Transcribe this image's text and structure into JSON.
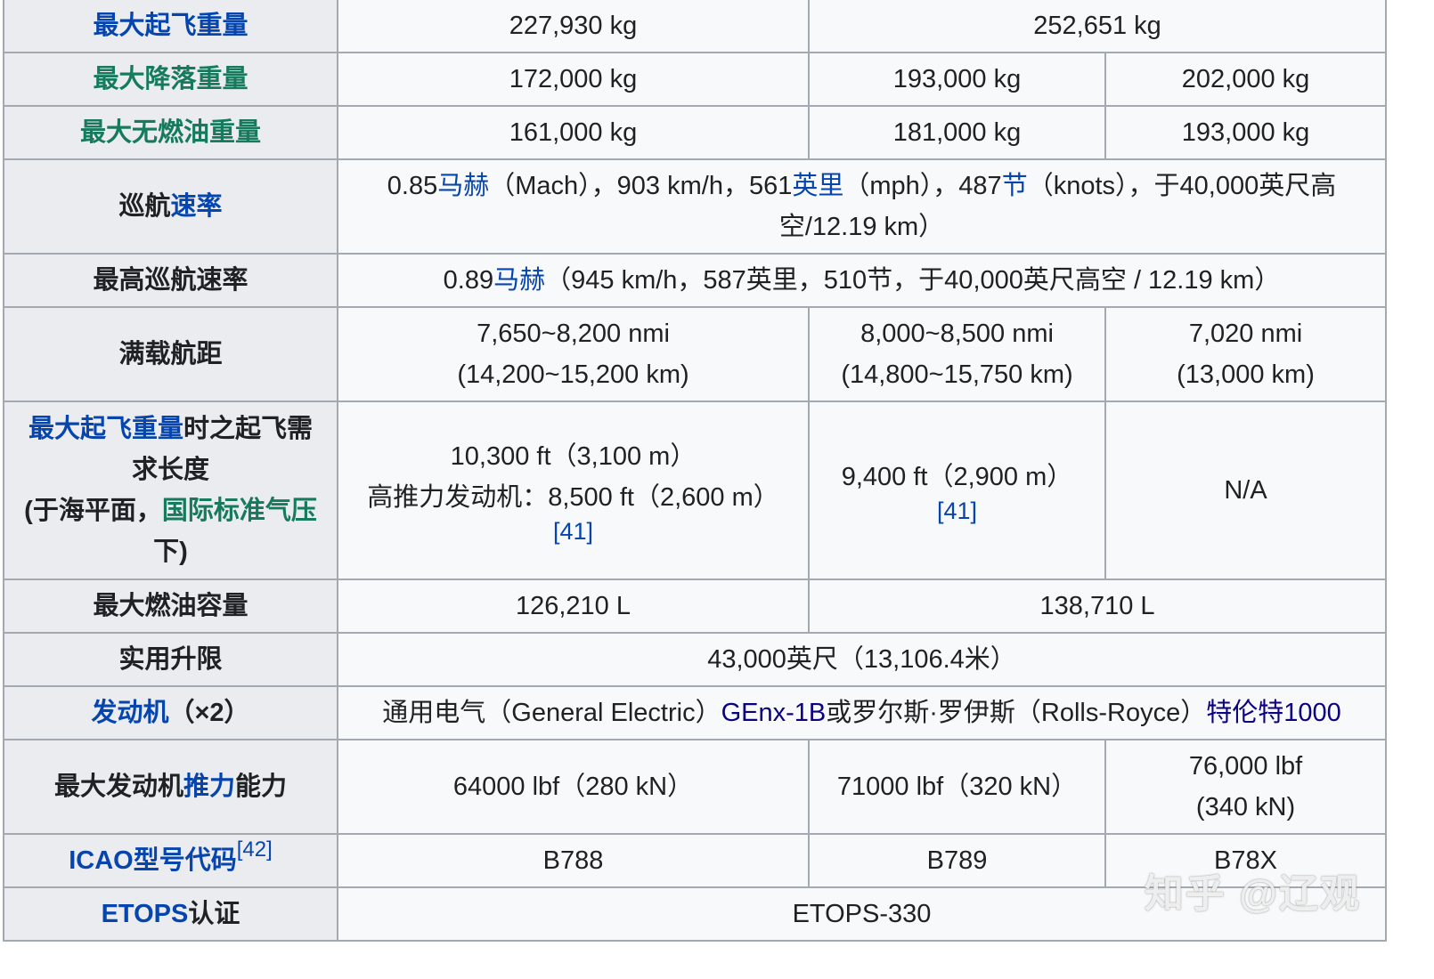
{
  "rows": {
    "mtow": {
      "label": "最大起飞重量",
      "v1": "227,930 kg",
      "v2": "252,651 kg"
    },
    "mlw": {
      "label": "最大降落重量",
      "v1": "172,000 kg",
      "v2": "193,000 kg",
      "v3": "202,000 kg"
    },
    "mzfw": {
      "label": "最大无燃油重量",
      "v1": "161,000 kg",
      "v2": "181,000 kg",
      "v3": "193,000 kg"
    },
    "cruise": {
      "label_pre": "巡航",
      "label_link": "速率",
      "p1": "0.85",
      "l1": "马赫",
      "p2": "（Mach），903 km/h，561",
      "l2": "英里",
      "p3": "（mph），487",
      "l3": "节",
      "p4": "（knots），于40,000英尺高",
      "p5": "空/12.19 km）"
    },
    "maxcruise": {
      "label": "最高巡航速率",
      "p1": "0.89",
      "l1": "马赫",
      "p2": "（945 km/h，587英里，510节，于40,000英尺高空 / 12.19 km）"
    },
    "range": {
      "label": "满载航距",
      "v1a": "7,650~8,200 nmi",
      "v1b": "(14,200~15,200 km)",
      "v2a": "8,000~8,500 nmi",
      "v2b": "(14,800~15,750 km)",
      "v3a": "7,020 nmi",
      "v3b": "(13,000 km)"
    },
    "takeoff": {
      "label_link1": "最大起飞重量",
      "label_t1": "时之起飞需",
      "label_t2": "求长度",
      "label_t3": "(于海平面，",
      "label_link2": "国际标准气压",
      "label_t4": "下)",
      "v1a": "10,300 ft（3,100 m）",
      "v1b": "高推力发动机：8,500 ft（2,600 m）",
      "v1ref": "[41]",
      "v2a": "9,400 ft（2,900 m）",
      "v2ref": "[41]",
      "v3": "N/A"
    },
    "fuel": {
      "label": "最大燃油容量",
      "v1": "126,210 L",
      "v2": "138,710 L"
    },
    "ceiling": {
      "label": "实用升限",
      "v": "43,000英尺（13,106.4米）"
    },
    "engines": {
      "label_link": "发动机",
      "label_suffix": "（×2）",
      "p1": "通用电气（General Electric）",
      "l1": "GEnx-1B",
      "p2": "或罗尔斯·罗伊斯（Rolls-Royce）",
      "l2": "特伦特1000"
    },
    "thrust": {
      "label_pre": "最大发动机",
      "label_link": "推力",
      "label_post": "能力",
      "v1": "64000 lbf（280 kN）",
      "v2": "71000 lbf（320 kN）",
      "v3a": "76,000 lbf",
      "v3b": "(340 kN)"
    },
    "icao": {
      "label_link": "ICAO型号代码",
      "label_ref": "[42]",
      "v1": "B788",
      "v2": "B789",
      "v3": "B78X"
    },
    "etops": {
      "label_link": "ETOPS",
      "label_post": "认证",
      "v": "ETOPS-330"
    }
  },
  "watermark": "知乎 @辽观",
  "colors": {
    "link": "#0645ad",
    "link_green": "#167a5d",
    "link_dark": "#0b0080",
    "border": "#a2a9b1",
    "header_bg": "#eaecf0",
    "cell_bg": "#f8f9fa"
  }
}
